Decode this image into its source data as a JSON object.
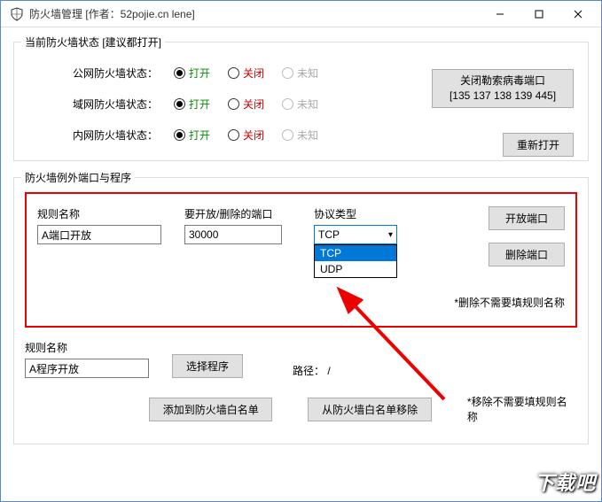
{
  "window": {
    "title": "防火墙管理  [作者：52pojie.cn lene]"
  },
  "group1": {
    "title": "当前防火墙状态  [建议都打开]",
    "rows": {
      "public": "公网防火墙状态：",
      "domain": "域网防火墙状态：",
      "private": "内网防火墙状态："
    },
    "radio": {
      "open": "打开",
      "close": "关闭",
      "unknown": "未知"
    },
    "btn_close_ports_l1": "关闭勒索病毒端口",
    "btn_close_ports_l2": "[135 137 138 139 445]",
    "btn_reopen": "重新打开"
  },
  "group2": {
    "title": "防火墙例外端口与程序",
    "rule_name_label": "规则名称",
    "rule_name_value": "A端口开放",
    "port_label": "要开放/删除的端口",
    "port_value": "30000",
    "proto_label": "协议类型",
    "proto_selected": "TCP",
    "proto_options": [
      "TCP",
      "UDP"
    ],
    "btn_open_port": "开放端口",
    "btn_del_port": "删除端口",
    "note_del": "*删除不需要填规则名称",
    "rule_name2_label": "规则名称",
    "rule_name2_value": "A程序开放",
    "btn_choose_prog": "选择程序",
    "path_label": "路径：",
    "path_value": "/",
    "btn_add_whitelist": "添加到防火墙白名单",
    "btn_remove_whitelist": "从防火墙白名单移除",
    "note_remove": "*移除不需要填规则名称"
  },
  "watermark": "下载吧"
}
